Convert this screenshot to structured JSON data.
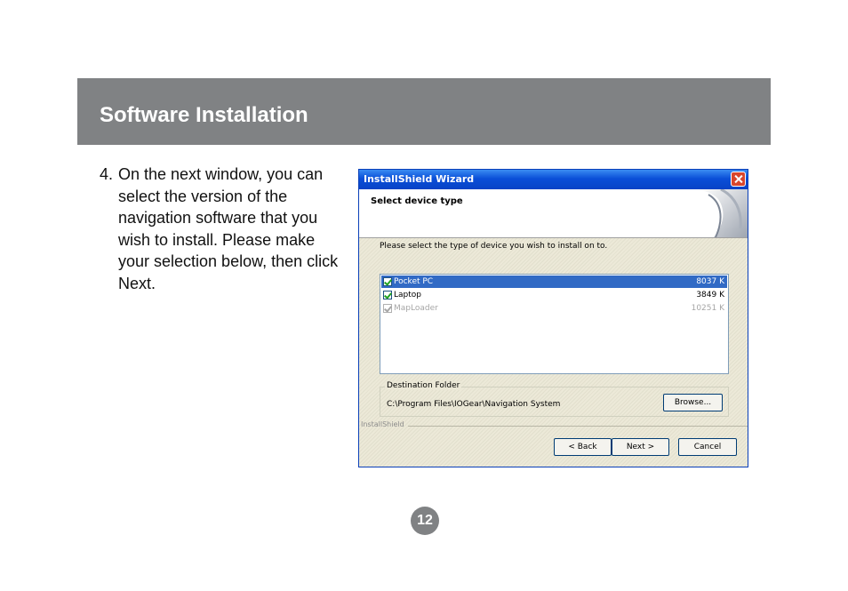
{
  "section": {
    "title": "Software Installation"
  },
  "instruction": {
    "number": "4.",
    "text": "On the next window, you can select the version of the navigation software that you wish to install.  Please make your selection below, then click Next."
  },
  "wizard": {
    "window_title": "InstallShield Wizard",
    "step_title": "Select device type",
    "prompt": "Please select the type of device you wish to install on to.",
    "items": [
      {
        "name": "Pocket PC",
        "size": "8037 K",
        "checked": true,
        "selected": true,
        "enabled": true
      },
      {
        "name": "Laptop",
        "size": "3849 K",
        "checked": true,
        "selected": false,
        "enabled": true
      },
      {
        "name": "MapLoader",
        "size": "10251 K",
        "checked": true,
        "selected": false,
        "enabled": false
      }
    ],
    "destination": {
      "legend": "Destination Folder",
      "path": "C:\\Program Files\\IOGear\\Navigation System",
      "browse_label": "Browse..."
    },
    "brand": "InstallShield",
    "buttons": {
      "back": "< Back",
      "next": "Next >",
      "cancel": "Cancel"
    }
  },
  "page_number": "12",
  "colors": {
    "band": "#808284",
    "title_bar": "#0a4fd8",
    "selection": "#316ac5"
  }
}
